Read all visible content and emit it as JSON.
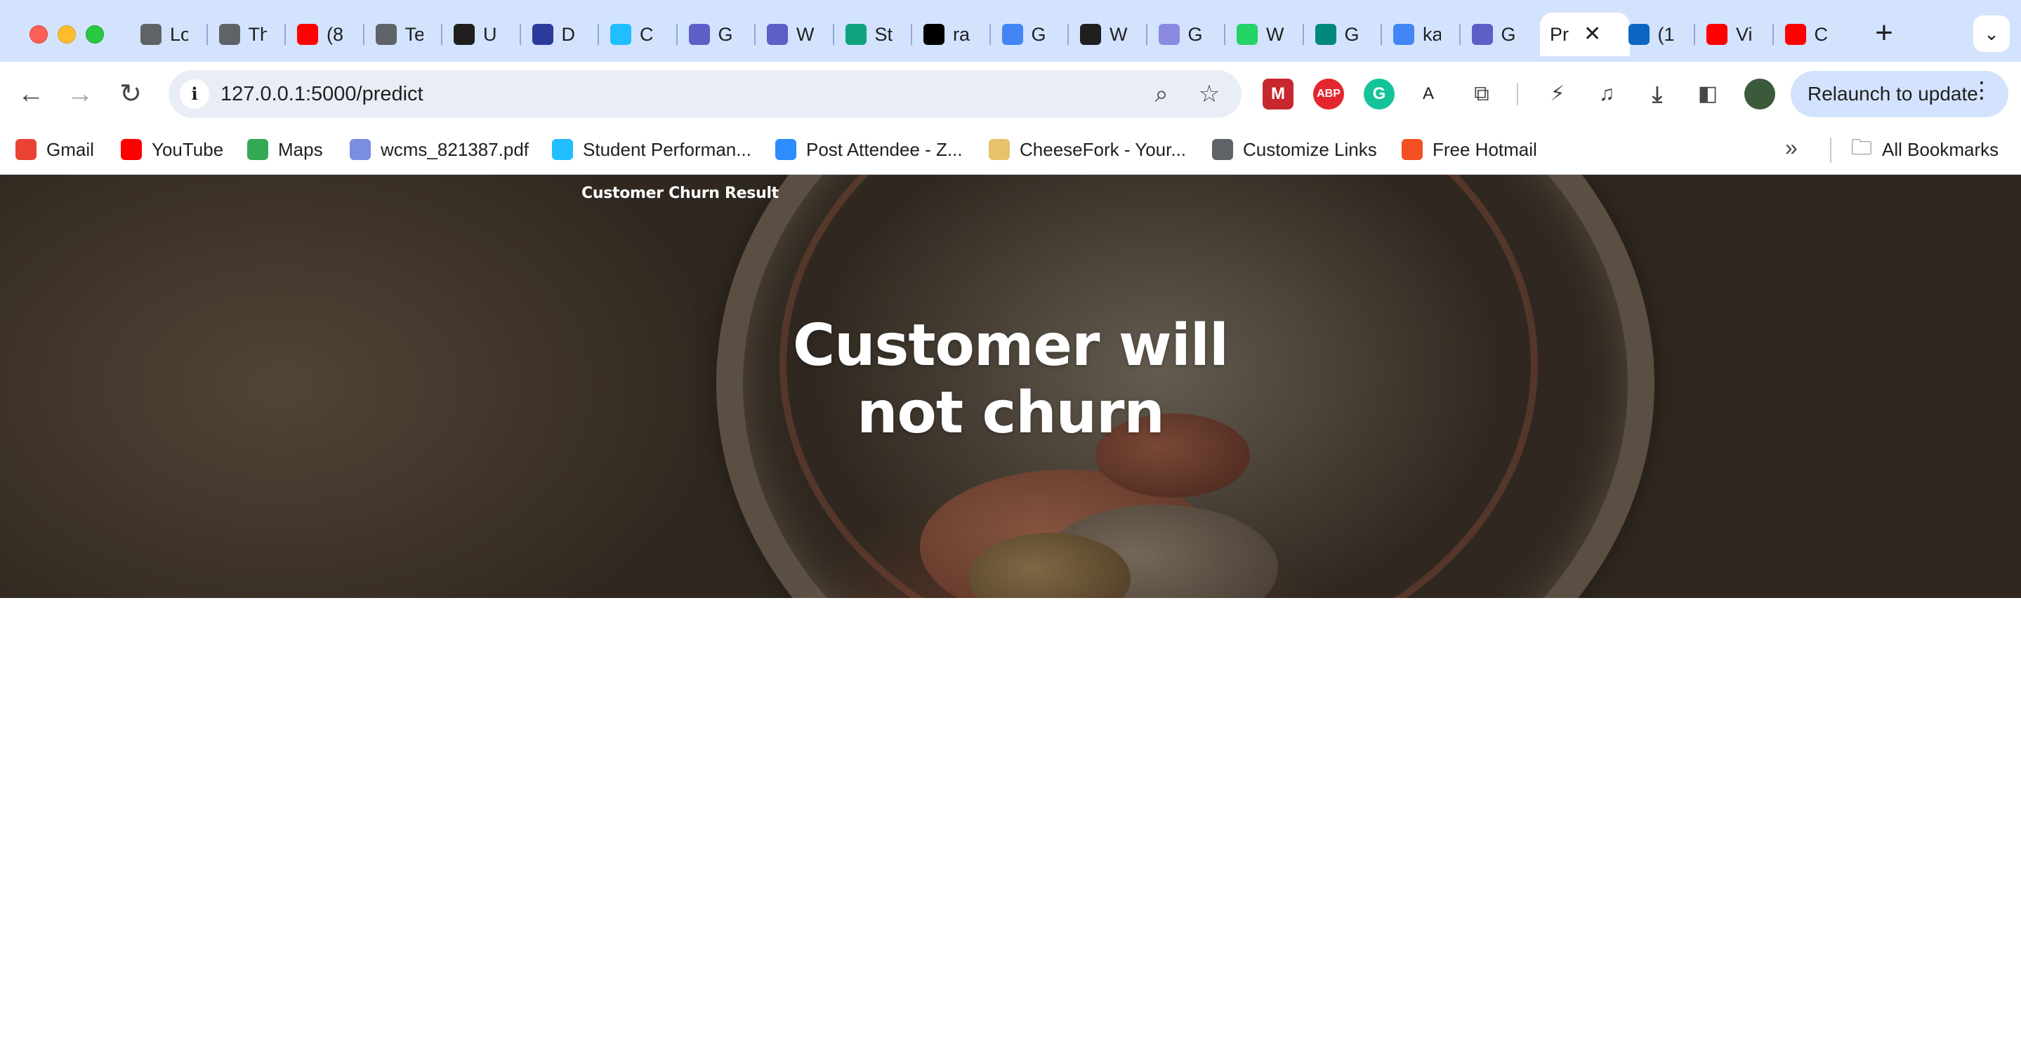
{
  "browser": {
    "tabs": [
      {
        "title": "Lo",
        "icon": "link-icon",
        "color": "#5f6368"
      },
      {
        "title": "Th",
        "icon": "github-icon",
        "color": "#5f6368"
      },
      {
        "title": "(8",
        "icon": "youtube-icon",
        "color": "#ff0000"
      },
      {
        "title": "Te",
        "icon": "github-icon",
        "color": "#5f6368"
      },
      {
        "title": "U",
        "icon": "record-icon",
        "color": "#1f1f1f"
      },
      {
        "title": "D",
        "icon": "doc-icon",
        "color": "#2b3a9b"
      },
      {
        "title": "C",
        "icon": "kaggle-icon",
        "color": "#20beff"
      },
      {
        "title": "G",
        "icon": "printer-icon",
        "color": "#5b5fc7"
      },
      {
        "title": "W",
        "icon": "printer-icon",
        "color": "#5b5fc7"
      },
      {
        "title": "St",
        "icon": "chatgpt-icon",
        "color": "#10a37f"
      },
      {
        "title": "ra",
        "icon": "github-icon",
        "color": "#000000"
      },
      {
        "title": "G",
        "icon": "gemini-icon",
        "color": "#4285f4"
      },
      {
        "title": "W",
        "icon": "globe-icon",
        "color": "#1f1f1f"
      },
      {
        "title": "G",
        "icon": "gemini-round-icon",
        "color": "#8a8ae0"
      },
      {
        "title": "W",
        "icon": "whatsapp-icon",
        "color": "#25d366"
      },
      {
        "title": "G",
        "icon": "meet-icon",
        "color": "#00897b"
      },
      {
        "title": "ka",
        "icon": "google-icon",
        "color": "#4285f4"
      },
      {
        "title": "G",
        "icon": "printer-icon",
        "color": "#5b5fc7"
      },
      {
        "title": "Pr",
        "icon": "page-icon",
        "color": "#ffffff",
        "active": true
      },
      {
        "title": "(1",
        "icon": "linkedin-icon",
        "color": "#0a66c2"
      },
      {
        "title": "Vi",
        "icon": "youtube-icon",
        "color": "#ff0000"
      },
      {
        "title": "C",
        "icon": "youtube-icon",
        "color": "#ff0000"
      }
    ],
    "url": "127.0.0.1:5000/predict",
    "relaunch_label": "Relaunch to update",
    "bookmarks": [
      {
        "label": "Gmail",
        "icon": "gmail-icon",
        "color": "#ea4335"
      },
      {
        "label": "YouTube",
        "icon": "youtube-icon",
        "color": "#ff0000"
      },
      {
        "label": "Maps",
        "icon": "maps-icon",
        "color": "#34a853"
      },
      {
        "label": "wcms_821387.pdf",
        "icon": "globe-icon",
        "color": "#7b8de0"
      },
      {
        "label": "Student Performan...",
        "icon": "kaggle-icon",
        "color": "#20beff"
      },
      {
        "label": "Post Attendee - Z...",
        "icon": "zoom-icon",
        "color": "#2d8cff"
      },
      {
        "label": "CheeseFork - Your...",
        "icon": "cheese-icon",
        "color": "#e8c16a"
      },
      {
        "label": "Customize Links",
        "icon": "globe-icon",
        "color": "#5f6368"
      },
      {
        "label": "Free Hotmail",
        "icon": "microsoft-icon",
        "color": "#f25022"
      }
    ],
    "all_bookmarks_label": "All Bookmarks"
  },
  "page": {
    "brand": "Customer Churn Result",
    "result_line1": "Customer will",
    "result_line2": "not churn"
  }
}
